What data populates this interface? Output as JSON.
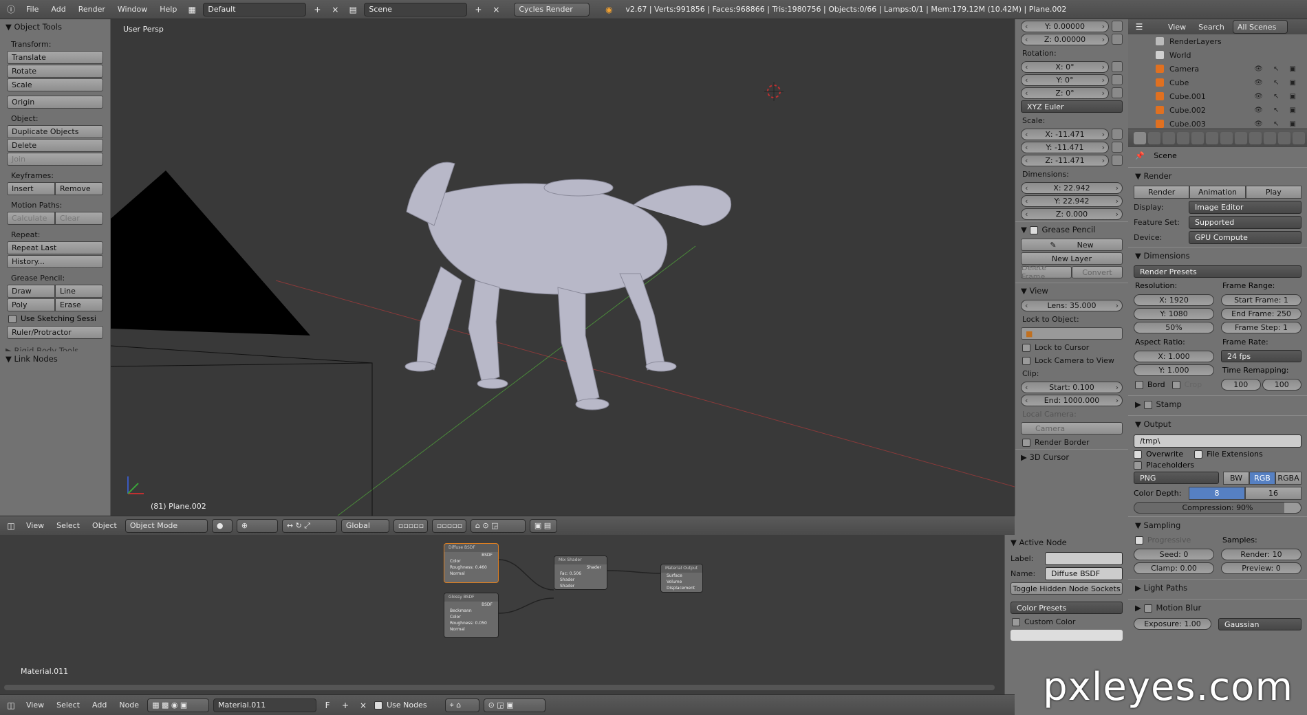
{
  "topbar": {
    "menus": [
      "File",
      "Add",
      "Render",
      "Window",
      "Help"
    ],
    "layout": "Default",
    "scene": "Scene",
    "engine": "Cycles Render",
    "stats": "v2.67 | Verts:991856 | Faces:968866 | Tris:1980756 | Objects:0/66 | Lamps:0/1 | Mem:179.12M (10.42M) | Plane.002"
  },
  "tools": {
    "title": "Object Tools",
    "transform_label": "Transform:",
    "translate": "Translate",
    "rotate": "Rotate",
    "scale": "Scale",
    "origin": "Origin",
    "object_label": "Object:",
    "duplicate": "Duplicate Objects",
    "delete": "Delete",
    "join": "Join",
    "keyframes_label": "Keyframes:",
    "insert": "Insert",
    "remove": "Remove",
    "motion_label": "Motion Paths:",
    "calculate": "Calculate",
    "clear": "Clear",
    "repeat_label": "Repeat:",
    "repeat_last": "Repeat Last",
    "history": "History...",
    "grease_label": "Grease Pencil:",
    "draw": "Draw",
    "line": "Line",
    "poly": "Poly",
    "erase": "Erase",
    "use_sketching": "Use Sketching Sessi",
    "ruler": "Ruler/Protractor",
    "rigid": "Rigid Body Tools",
    "link_nodes": "Link Nodes"
  },
  "viewport": {
    "label": "User Persp",
    "object_info": "(81) Plane.002",
    "header": {
      "menus": [
        "View",
        "Select",
        "Object"
      ],
      "mode": "Object Mode",
      "orientation": "Global"
    }
  },
  "npanel": {
    "loc_y": "Y: 0.00000",
    "loc_z": "Z: 0.00000",
    "rotation_label": "Rotation:",
    "rot_x": "X: 0°",
    "rot_y": "Y: 0°",
    "rot_z": "Z: 0°",
    "euler": "XYZ Euler",
    "scale_label": "Scale:",
    "sc_x": "X: -11.471",
    "sc_y": "Y: -11.471",
    "sc_z": "Z: -11.471",
    "dims_label": "Dimensions:",
    "dim_x": "X: 22.942",
    "dim_y": "Y: 22.942",
    "dim_z": "Z: 0.000",
    "grease": "Grease Pencil",
    "new": "New",
    "new_layer": "New Layer",
    "delete_frame": "Delete Frame",
    "convert": "Convert",
    "view": "View",
    "lens": "Lens: 35.000",
    "lock_obj": "Lock to Object:",
    "lock_cursor": "Lock to Cursor",
    "lock_camera": "Lock Camera to View",
    "clip": "Clip:",
    "clip_start": "Start: 0.100",
    "clip_end": "End: 1000.000",
    "local_camera": "Local Camera:",
    "camera": "Camera",
    "render_border": "Render Border",
    "cursor3d": "3D Cursor"
  },
  "outliner": {
    "menus": [
      "View",
      "Search"
    ],
    "filter": "All Scenes",
    "rows": [
      {
        "name": "RenderLayers",
        "color": "#bbbbbb"
      },
      {
        "name": "World",
        "color": "#d0d0d0"
      },
      {
        "name": "Camera",
        "color": "#e07020"
      },
      {
        "name": "Cube",
        "color": "#e07020"
      },
      {
        "name": "Cube.001",
        "color": "#e07020"
      },
      {
        "name": "Cube.002",
        "color": "#e07020"
      },
      {
        "name": "Cube.003",
        "color": "#e07020"
      }
    ]
  },
  "properties": {
    "scene": "Scene",
    "render_header": "Render",
    "render_btn": "Render",
    "animation_btn": "Animation",
    "play_btn": "Play",
    "display_label": "Display:",
    "display": "Image Editor",
    "featureset_label": "Feature Set:",
    "featureset": "Supported",
    "device_label": "Device:",
    "device": "GPU Compute",
    "dimensions": "Dimensions",
    "presets": "Render Presets",
    "resolution": "Resolution:",
    "res_x": "X: 1920",
    "res_y": "Y: 1080",
    "res_pct": "50%",
    "frame_range": "Frame Range:",
    "start_frame": "Start Frame: 1",
    "end_frame": "End Frame: 250",
    "frame_step": "Frame Step: 1",
    "aspect": "Aspect Ratio:",
    "asp_x": "X: 1.000",
    "asp_y": "Y: 1.000",
    "framerate_label": "Frame Rate:",
    "framerate": "24 fps",
    "time_remap": "Time Remapping:",
    "remap_old": "100",
    "remap_new": "100",
    "bord": "Bord",
    "crop": "Crop",
    "stamp": "Stamp",
    "output": "Output",
    "output_path": "/tmp\\",
    "overwrite": "Overwrite",
    "file_ext": "File Extensions",
    "placeholders": "Placeholders",
    "format": "PNG",
    "bw": "BW",
    "rgb": "RGB",
    "rgba": "RGBA",
    "color_depth": "Color Depth:",
    "depth_8": "8",
    "depth_16": "16",
    "compression": "Compression: 90%",
    "compression_value": 0.9,
    "sampling": "Sampling",
    "progressive": "Progressive",
    "samples_label": "Samples:",
    "seed": "Seed: 0",
    "render_samples": "Render: 10",
    "clamp": "Clamp: 0.00",
    "preview": "Preview: 0",
    "light_paths": "Light Paths",
    "motion_blur": "Motion Blur",
    "exposure": "Exposure: 1.00",
    "filter": "Gaussian"
  },
  "node_editor": {
    "header": {
      "menus": [
        "View",
        "Select",
        "Add",
        "Node"
      ],
      "material": "Material.011",
      "fake": "F",
      "use_nodes": "Use Nodes"
    },
    "material_label": "Material.011",
    "nodes": {
      "diffuse": {
        "title": "Diffuse BSDF",
        "out": "BSDF",
        "color": "Color",
        "rough": "Roughness: 0.460",
        "normal": "Normal"
      },
      "glossy": {
        "title": "Glossy BSDF",
        "out": "BSDF",
        "dist": "Beckmann",
        "color": "Color",
        "rough": "Roughness: 0.050",
        "normal": "Normal"
      },
      "mix": {
        "title": "Mix Shader",
        "out": "Shader",
        "fac": "Fac: 0.506",
        "s1": "Shader",
        "s2": "Shader"
      },
      "output": {
        "title": "Material Output",
        "surface": "Surface",
        "volume": "Volume",
        "disp": "Displacement"
      }
    },
    "side": {
      "active_node": "Active Node",
      "label_label": "Label:",
      "name_label": "Name:",
      "name": "Diffuse BSDF",
      "toggle": "Toggle Hidden Node Sockets",
      "color_presets": "Color Presets",
      "custom_color": "Custom Color"
    }
  },
  "watermark": "pxleyes.com"
}
